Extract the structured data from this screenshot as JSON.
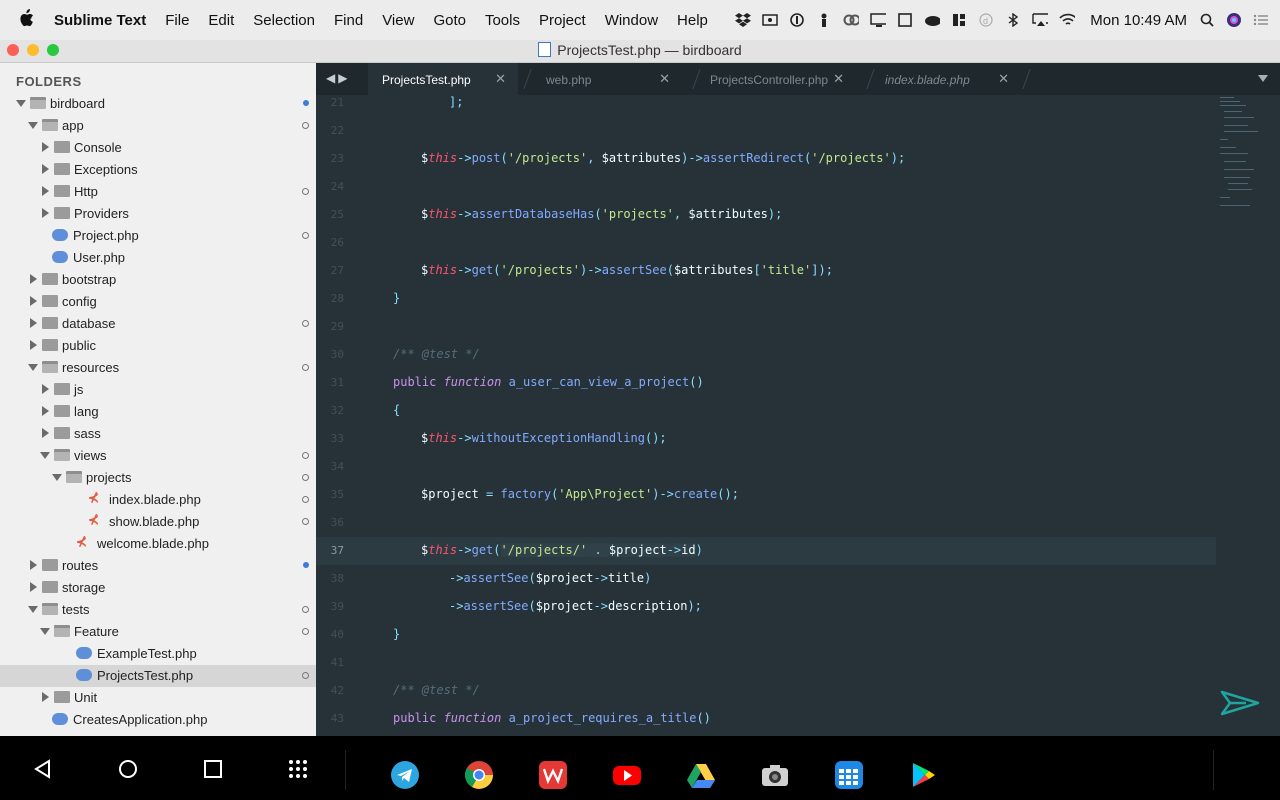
{
  "menubar": {
    "apple_icon": "apple-icon",
    "app_name": "Sublime Text",
    "menus": [
      "File",
      "Edit",
      "Selection",
      "Find",
      "View",
      "Goto",
      "Tools",
      "Project",
      "Window",
      "Help"
    ],
    "clock": "Mon 10:49 AM",
    "status_icons": [
      "dropbox-icon",
      "screen-record-icon",
      "onepassword-icon",
      "alfred-icon",
      "creative-cloud-icon",
      "display-icon",
      "window-icon",
      "cloud-icon",
      "grid-icon",
      "circle-d-icon",
      "bluetooth-icon",
      "airplay-icon",
      "wifi-icon"
    ]
  },
  "window": {
    "title": "ProjectsTest.php — birdboard",
    "traffic_lights": {
      "close": "#fc5f57",
      "minimize": "#fdbc2e",
      "zoom": "#28c840"
    }
  },
  "sidebar": {
    "header": "FOLDERS",
    "items": [
      {
        "label": "birdboard",
        "type": "folder-open",
        "indicator": "blue"
      },
      {
        "label": "app",
        "type": "folder-open",
        "indicator": "ring"
      },
      {
        "label": "Console",
        "type": "folder",
        "indicator": ""
      },
      {
        "label": "Exceptions",
        "type": "folder",
        "indicator": ""
      },
      {
        "label": "Http",
        "type": "folder",
        "indicator": "ring"
      },
      {
        "label": "Providers",
        "type": "folder",
        "indicator": ""
      },
      {
        "label": "Project.php",
        "type": "php",
        "indicator": "ring"
      },
      {
        "label": "User.php",
        "type": "php",
        "indicator": ""
      },
      {
        "label": "bootstrap",
        "type": "folder",
        "indicator": ""
      },
      {
        "label": "config",
        "type": "folder",
        "indicator": ""
      },
      {
        "label": "database",
        "type": "folder",
        "indicator": "ring"
      },
      {
        "label": "public",
        "type": "folder",
        "indicator": ""
      },
      {
        "label": "resources",
        "type": "folder-open",
        "indicator": "ring"
      },
      {
        "label": "js",
        "type": "folder",
        "indicator": ""
      },
      {
        "label": "lang",
        "type": "folder",
        "indicator": ""
      },
      {
        "label": "sass",
        "type": "folder",
        "indicator": ""
      },
      {
        "label": "views",
        "type": "folder-open",
        "indicator": "ring"
      },
      {
        "label": "projects",
        "type": "folder-open",
        "indicator": "ring"
      },
      {
        "label": "index.blade.php",
        "type": "blade",
        "indicator": "ring"
      },
      {
        "label": "show.blade.php",
        "type": "blade",
        "indicator": "ring"
      },
      {
        "label": "welcome.blade.php",
        "type": "blade",
        "indicator": ""
      },
      {
        "label": "routes",
        "type": "folder",
        "indicator": "blue"
      },
      {
        "label": "storage",
        "type": "folder",
        "indicator": ""
      },
      {
        "label": "tests",
        "type": "folder-open",
        "indicator": "ring"
      },
      {
        "label": "Feature",
        "type": "folder-open",
        "indicator": "ring"
      },
      {
        "label": "ExampleTest.php",
        "type": "php",
        "indicator": ""
      },
      {
        "label": "ProjectsTest.php",
        "type": "php",
        "indicator": "ring",
        "selected": true
      },
      {
        "label": "Unit",
        "type": "folder",
        "indicator": ""
      },
      {
        "label": "CreatesApplication.php",
        "type": "php",
        "indicator": ""
      }
    ]
  },
  "tabs": [
    {
      "label": "ProjectsTest.php",
      "active": true,
      "italic": false
    },
    {
      "label": "web.php",
      "active": false,
      "italic": false
    },
    {
      "label": "ProjectsController.php",
      "active": false,
      "italic": false
    },
    {
      "label": "index.blade.php",
      "active": false,
      "italic": true
    }
  ],
  "editor": {
    "current_line": "37",
    "lines": [
      {
        "n": "21",
        "indent": 2,
        "tokens": [
          [
            "p",
            "];"
          ]
        ]
      },
      {
        "n": "22",
        "indent": 0,
        "tokens": []
      },
      {
        "n": "23",
        "indent": 1,
        "tokens": [
          [
            "var",
            "$"
          ],
          [
            "this",
            "this"
          ],
          [
            "op",
            "->"
          ],
          [
            "fn",
            "post"
          ],
          [
            "p",
            "("
          ],
          [
            "str",
            "'/projects'"
          ],
          [
            "p",
            ", "
          ],
          [
            "var",
            "$attributes"
          ],
          [
            "p",
            ")"
          ],
          [
            "op",
            "->"
          ],
          [
            "fn",
            "assertRedirect"
          ],
          [
            "p",
            "("
          ],
          [
            "str",
            "'/projects'"
          ],
          [
            "p",
            ");"
          ]
        ]
      },
      {
        "n": "24",
        "indent": 0,
        "tokens": []
      },
      {
        "n": "25",
        "indent": 1,
        "tokens": [
          [
            "var",
            "$"
          ],
          [
            "this",
            "this"
          ],
          [
            "op",
            "->"
          ],
          [
            "fn",
            "assertDatabaseHas"
          ],
          [
            "p",
            "("
          ],
          [
            "str",
            "'projects'"
          ],
          [
            "p",
            ", "
          ],
          [
            "var",
            "$attributes"
          ],
          [
            "p",
            ");"
          ]
        ]
      },
      {
        "n": "26",
        "indent": 0,
        "tokens": []
      },
      {
        "n": "27",
        "indent": 1,
        "tokens": [
          [
            "var",
            "$"
          ],
          [
            "this",
            "this"
          ],
          [
            "op",
            "->"
          ],
          [
            "fn",
            "get"
          ],
          [
            "p",
            "("
          ],
          [
            "str",
            "'/projects'"
          ],
          [
            "p",
            ")"
          ],
          [
            "op",
            "->"
          ],
          [
            "fn",
            "assertSee"
          ],
          [
            "p",
            "("
          ],
          [
            "var",
            "$attributes"
          ],
          [
            "p",
            "["
          ],
          [
            "str",
            "'title'"
          ],
          [
            "p",
            "]);"
          ]
        ]
      },
      {
        "n": "28",
        "indent": 0,
        "tokens": [
          [
            "p",
            "}"
          ]
        ]
      },
      {
        "n": "29",
        "indent": 0,
        "tokens": []
      },
      {
        "n": "30",
        "indent": 0,
        "tokens": [
          [
            "cm",
            "/** @test */"
          ]
        ]
      },
      {
        "n": "31",
        "indent": 0,
        "tokens": [
          [
            "kw",
            "public "
          ],
          [
            "kwi",
            "function "
          ],
          [
            "fn",
            "a_user_can_view_a_project"
          ],
          [
            "p",
            "()"
          ]
        ]
      },
      {
        "n": "32",
        "indent": 0,
        "tokens": [
          [
            "p",
            "{"
          ]
        ]
      },
      {
        "n": "33",
        "indent": 1,
        "tokens": [
          [
            "var",
            "$"
          ],
          [
            "this",
            "this"
          ],
          [
            "op",
            "->"
          ],
          [
            "fn",
            "withoutExceptionHandling"
          ],
          [
            "p",
            "();"
          ]
        ]
      },
      {
        "n": "34",
        "indent": 0,
        "tokens": []
      },
      {
        "n": "35",
        "indent": 1,
        "tokens": [
          [
            "var",
            "$project"
          ],
          [
            "op",
            " = "
          ],
          [
            "fn",
            "factory"
          ],
          [
            "p",
            "("
          ],
          [
            "str",
            "'App\\Project'"
          ],
          [
            "p",
            ")"
          ],
          [
            "op",
            "->"
          ],
          [
            "fn",
            "create"
          ],
          [
            "p",
            "();"
          ]
        ]
      },
      {
        "n": "36",
        "indent": 0,
        "tokens": []
      },
      {
        "n": "37",
        "indent": 1,
        "tokens": [
          [
            "var",
            "$"
          ],
          [
            "this",
            "this"
          ],
          [
            "op",
            "->"
          ],
          [
            "fn",
            "get"
          ],
          [
            "p",
            "("
          ],
          [
            "hlstr",
            "'/projects/'"
          ],
          [
            "hlop",
            " . "
          ],
          [
            "hlvar",
            "$project"
          ],
          [
            "hlop",
            "->"
          ],
          [
            "hlvar",
            "id"
          ],
          [
            "p",
            ")"
          ]
        ]
      },
      {
        "n": "38",
        "indent": 2,
        "tokens": [
          [
            "op",
            "->"
          ],
          [
            "fn",
            "assertSee"
          ],
          [
            "p",
            "("
          ],
          [
            "var",
            "$project"
          ],
          [
            "op",
            "->"
          ],
          [
            "var",
            "title"
          ],
          [
            "p",
            ")"
          ]
        ]
      },
      {
        "n": "39",
        "indent": 2,
        "tokens": [
          [
            "op",
            "->"
          ],
          [
            "fn",
            "assertSee"
          ],
          [
            "p",
            "("
          ],
          [
            "var",
            "$project"
          ],
          [
            "op",
            "->"
          ],
          [
            "var",
            "description"
          ],
          [
            "p",
            ");"
          ]
        ]
      },
      {
        "n": "40",
        "indent": 0,
        "tokens": [
          [
            "p",
            "}"
          ]
        ]
      },
      {
        "n": "41",
        "indent": 0,
        "tokens": []
      },
      {
        "n": "42",
        "indent": 0,
        "tokens": [
          [
            "cm",
            "/** @test */"
          ]
        ]
      },
      {
        "n": "43",
        "indent": 0,
        "tokens": [
          [
            "kw",
            "public "
          ],
          [
            "kwi",
            "function "
          ],
          [
            "fn",
            "a_project_requires_a_title"
          ],
          [
            "p",
            "()"
          ]
        ]
      }
    ]
  },
  "android_nav": {
    "buttons": [
      "back-icon",
      "home-icon",
      "recents-icon",
      "app-drawer-icon"
    ],
    "apps": [
      {
        "name": "telegram-icon",
        "color": "#2ca5e0"
      },
      {
        "name": "chrome-icon",
        "color": "#db4437"
      },
      {
        "name": "wps-office-icon",
        "color": "#e53935"
      },
      {
        "name": "youtube-icon",
        "color": "#ff0000"
      },
      {
        "name": "google-drive-icon",
        "color": "#1fa463"
      },
      {
        "name": "camera-icon",
        "color": "#d0d0d0"
      },
      {
        "name": "calendar-grid-icon",
        "color": "#1e88e5"
      },
      {
        "name": "play-store-icon",
        "color": "#00c3ff"
      }
    ]
  }
}
